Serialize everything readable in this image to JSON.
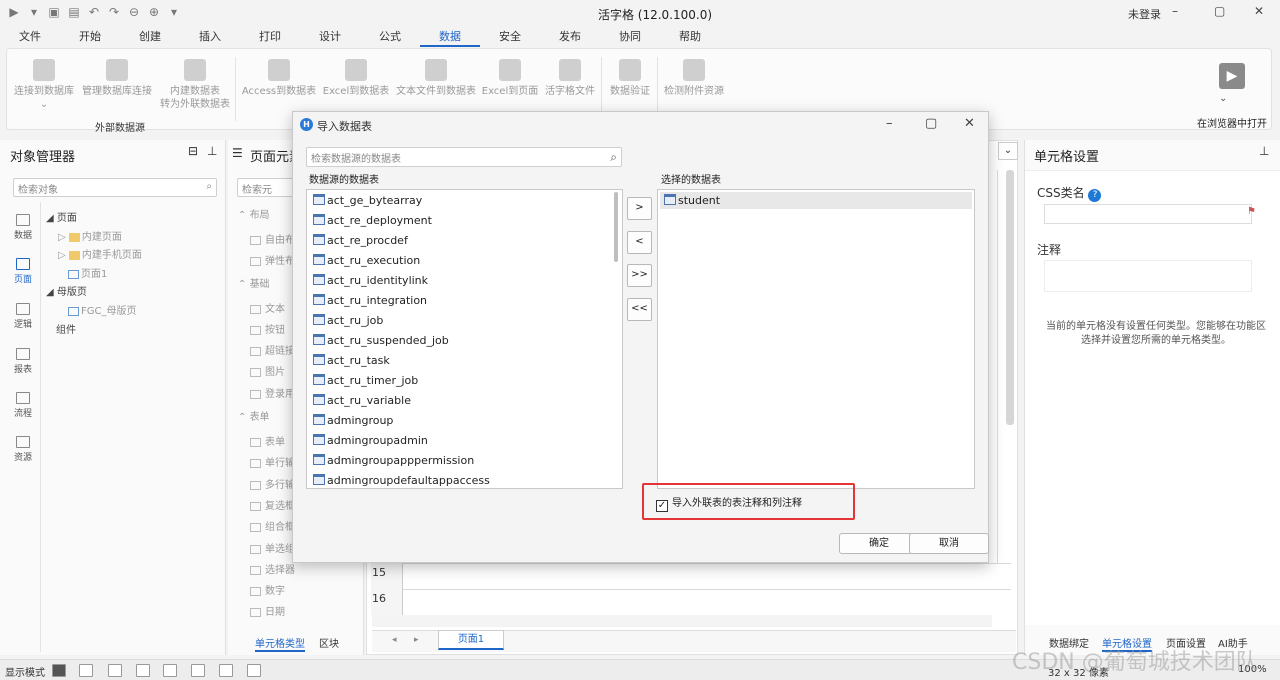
{
  "app": {
    "title": "活字格 (12.0.100.0)",
    "login": "未登录"
  },
  "menu": [
    "文件",
    "开始",
    "创建",
    "插入",
    "打印",
    "设计",
    "公式",
    "数据",
    "安全",
    "发布",
    "协同",
    "帮助"
  ],
  "menu_active_index": 7,
  "ribbon": {
    "connect_db": "连接到数据库",
    "manage_db": "管理数据库连接",
    "convert_internal": "内建数据表\n转为外联数据表",
    "group_label": "外部数据源",
    "access": "Access到数据表",
    "excel_table": "Excel到数据表",
    "text_file": "文本文件到数据表",
    "excel_page": "Excel到页面",
    "huozige_file": "活字格文件",
    "validate": "数据验证",
    "check_attach": "检测附件资源",
    "open_browser": "在浏览器中打开"
  },
  "left": {
    "title": "对象管理器",
    "search_placeholder": "检索对象",
    "vtabs": [
      "数据",
      "页面",
      "逻辑",
      "报表",
      "流程",
      "资源"
    ],
    "tree": {
      "pages": "页面",
      "builtin_pages": "内建页面",
      "builtin_mobile": "内建手机页面",
      "page1": "页面1",
      "master": "母版页",
      "fgc_master": "FGC_母版页",
      "components": "组件"
    }
  },
  "middle": {
    "title": "页面元素",
    "search_placeholder": "检索元",
    "sections": {
      "layout": "布局",
      "basic": "基础",
      "form": "表单"
    },
    "items": [
      "自由布",
      "弹性布",
      "文本",
      "按钮",
      "超链接",
      "图片",
      "登录用",
      "表单",
      "单行输",
      "多行输",
      "复选框",
      "组合框",
      "单选组",
      "选择器",
      "数字",
      "日期"
    ],
    "tabs": {
      "cell_type": "单元格类型",
      "region": "区块"
    }
  },
  "grid": {
    "rows": [
      "15",
      "16"
    ],
    "sheet_tab": "页面1"
  },
  "right": {
    "title": "单元格设置",
    "css_label": "CSS类名",
    "note_label": "注释",
    "info": "当前的单元格没有设置任何类型。您能够在功能区选择并设置您所需的单元格类型。",
    "tabs": [
      "数据绑定",
      "单元格设置",
      "页面设置",
      "AI助手"
    ],
    "active_tab_index": 1
  },
  "dialog": {
    "title": "导入数据表",
    "search_placeholder": "检索数据源的数据表",
    "source_label": "数据源的数据表",
    "selected_label": "选择的数据表",
    "source_tables": [
      "act_ge_bytearray",
      "act_re_deployment",
      "act_re_procdef",
      "act_ru_execution",
      "act_ru_identitylink",
      "act_ru_integration",
      "act_ru_job",
      "act_ru_suspended_job",
      "act_ru_task",
      "act_ru_timer_job",
      "act_ru_variable",
      "admingroup",
      "admingroupadmin",
      "admingroupapppermission",
      "admingroupdefaultappaccess"
    ],
    "selected_tables": [
      "student"
    ],
    "btn_add": ">",
    "btn_remove": "<",
    "btn_add_all": ">>",
    "btn_remove_all": "<<",
    "checkbox_label": "导入外联表的表注释和列注释",
    "checkbox_checked": true,
    "ok": "确定",
    "cancel": "取消"
  },
  "status": {
    "mode": "显示模式",
    "size": "32 x 32 像素",
    "zoom": "100%"
  },
  "watermark": "CSDN @葡萄城技术团队"
}
